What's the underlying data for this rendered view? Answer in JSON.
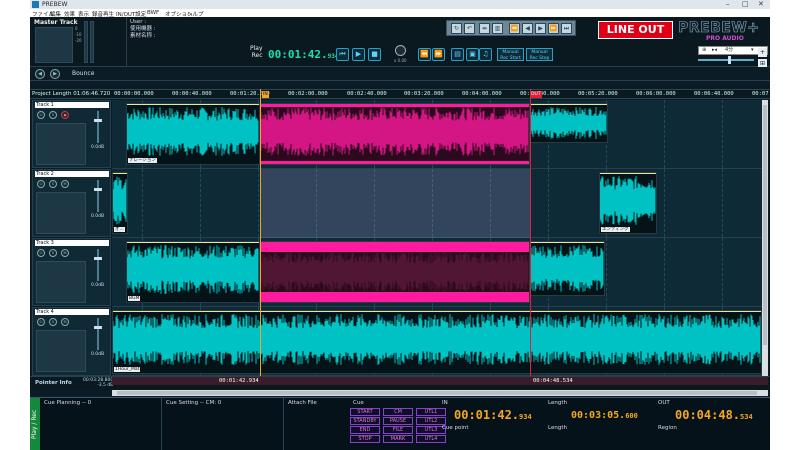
{
  "app": {
    "title": "PREBEW",
    "window_controls": [
      "–",
      "□",
      "✕"
    ]
  },
  "menu": [
    "ファイル",
    "編集",
    "効果",
    "表示",
    "録音再生",
    "IN/OUT設定",
    "BWF",
    "オプション",
    "ヘルプ"
  ],
  "master": {
    "label": "Master Track",
    "scale": [
      "0",
      "-10",
      "-20"
    ]
  },
  "user": {
    "line1": "User :",
    "line2": "使用機器 :",
    "line3": "素材名称 :"
  },
  "transport": {
    "play_label": "Play",
    "rec_label": "Rec",
    "time_main": "00:01:42.",
    "time_ms": "934",
    "knob_label": "x 0.00",
    "manual_rec_start_top": "Manual",
    "manual_rec_start_bottom": "Rec Start",
    "manual_rec_stop_top": "Manual",
    "manual_rec_stop_bottom": "Rec Stop"
  },
  "lineout": {
    "label": "LINE OUT",
    "brand": "PREBEW+",
    "brand_sub": "PRO AUDIO"
  },
  "zoom": {
    "value": "4分"
  },
  "bounce": {
    "label": "Bounce"
  },
  "ruler": {
    "project_length": "Project Length  01:06:46.720",
    "ticks": [
      "00:00:00.000",
      "00:00:40.000",
      "00:01:20.000",
      "00:02:00.000",
      "00:02:40.000",
      "00:03:20.000",
      "00:04:00.000",
      "00:04:40.000",
      "00:05:20.000",
      "00:06:00.000",
      "00:06:40.000",
      "00:07"
    ],
    "in_marker": "IN",
    "out_marker": "OUT"
  },
  "tracks": [
    {
      "name": "Track 1",
      "db": "0.0dB",
      "clips": [
        "ナレーション",
        "エンディング"
      ]
    },
    {
      "name": "Track 2",
      "db": "0.0dB",
      "clips": [
        "オ...",
        "エンディング"
      ]
    },
    {
      "name": "Track 3",
      "db": "0.0dB",
      "clips": [
        "BGM"
      ]
    },
    {
      "name": "Track 4",
      "db": "0.0dB",
      "clips": [
        "1Hour_Mat"
      ]
    }
  ],
  "pointer": {
    "label": "Pointer Info",
    "time": "00:03:28.800",
    "db": "-3.5 dB",
    "in_time": "00:01:42.934",
    "out_time": "00:04:48.534"
  },
  "bottom": {
    "play_rec": "Play / Rec",
    "cue_planning": "Cue Planning  -- 0",
    "cue_setting": "Cue Setting  -- CM: 0",
    "attach_file": "Attach File",
    "cue": "Cue",
    "cue_buttons": [
      "START",
      "CM",
      "UTL1",
      "STANDBY",
      "PAUSE",
      "UTL2",
      "END",
      "FILE",
      "UTL3",
      "STOP",
      "MARK",
      "UTL4"
    ],
    "in_label": "IN",
    "length_label": "Length",
    "out_label": "OUT",
    "in_time": "00:01:42.",
    "in_ms": "934",
    "length_time": "00:03:05.",
    "length_ms": "600",
    "out_time": "00:04:48.",
    "out_ms": "534",
    "cue_point": "Cue point",
    "length2": "Length",
    "region": "Region"
  },
  "colors": {
    "waveform": "#00f0f0",
    "selection": "#ff1aa0",
    "lineout": "#e00016",
    "timecode": "#19e0b0",
    "inout": "#f5a623"
  }
}
